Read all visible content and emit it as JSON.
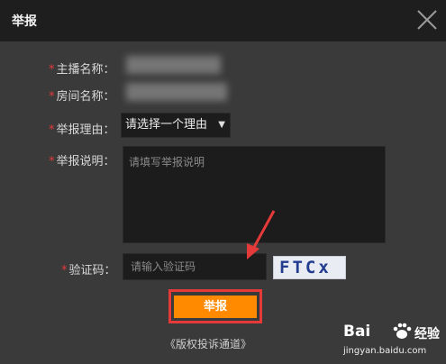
{
  "dialog": {
    "title": "举报",
    "close_icon": "close-icon"
  },
  "form": {
    "required_mark": "*",
    "streamer_label": "主播名称：",
    "room_label": "房间名称：",
    "reason_label": "举报理由：",
    "reason_selected": "请选择一个理由",
    "desc_label": "举报说明：",
    "desc_placeholder": "请填写举报说明",
    "captcha_label": "验证码：",
    "captcha_placeholder": "请输入验证码",
    "captcha_text": "FTCx",
    "submit_label": "举报",
    "appeal_link": "《版权投诉通道》"
  },
  "colors": {
    "accent_orange": "#ff8a00",
    "required_red": "#e23b3b",
    "highlight_red": "#e63a3a"
  },
  "watermark": {
    "logo": "Bai",
    "logo_after": "经验",
    "url": "jingyan.baidu.com"
  }
}
